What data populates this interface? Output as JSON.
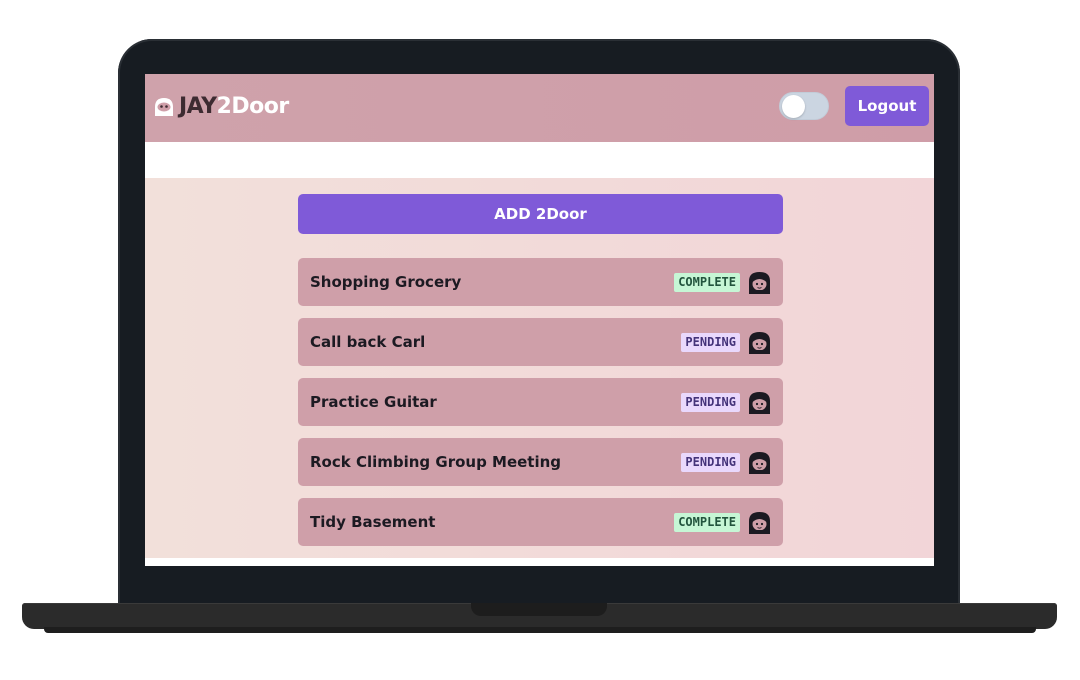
{
  "header": {
    "brand_part1": "JAY",
    "brand_part2": "2Door",
    "logout_label": "Logout",
    "theme_toggle": "off"
  },
  "main": {
    "add_button_label": "ADD 2Door",
    "todos": [
      {
        "title": "Shopping Grocery",
        "status": "COMPLETE"
      },
      {
        "title": "Call back Carl",
        "status": "PENDING"
      },
      {
        "title": "Practice Guitar",
        "status": "PENDING"
      },
      {
        "title": "Rock Climbing Group Meeting",
        "status": "PENDING"
      },
      {
        "title": "Tidy Basement",
        "status": "COMPLETE"
      }
    ]
  },
  "colors": {
    "accent": "#7f5ad8",
    "header_bg": "#cfa2ab",
    "item_bg": "#cf9fa9",
    "complete_bg": "#c6f6d5",
    "pending_bg": "#e9d8fd"
  },
  "icons": {
    "brand": "ghost-face-icon",
    "avatar": "girl-avatar-icon"
  }
}
